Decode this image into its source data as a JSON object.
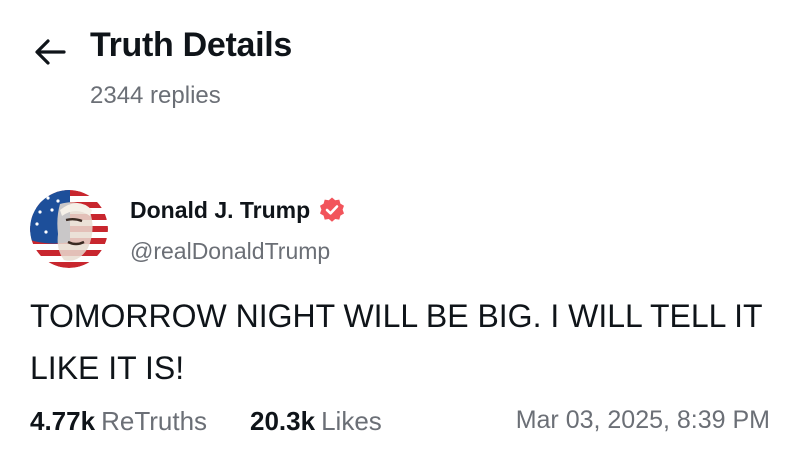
{
  "header": {
    "title": "Truth Details",
    "replies_text": "2344 replies",
    "back_icon": "arrow-left-icon"
  },
  "post": {
    "author": {
      "name": "Donald J. Trump",
      "handle": "@realDonaldTrump",
      "verified": true,
      "verified_icon": "verified-badge-icon",
      "verified_color": "#f2545b"
    },
    "text": "TOMORROW NIGHT WILL BE BIG. I WILL TELL IT LIKE IT IS!",
    "stats": {
      "retruths_count": "4.77k",
      "retruths_label": "ReTruths",
      "likes_count": "20.3k",
      "likes_label": "Likes"
    },
    "timestamp": "Mar 03, 2025, 8:39 PM"
  },
  "colors": {
    "text_primary": "#0f1419",
    "text_secondary": "#6b6f76",
    "background": "#ffffff"
  }
}
